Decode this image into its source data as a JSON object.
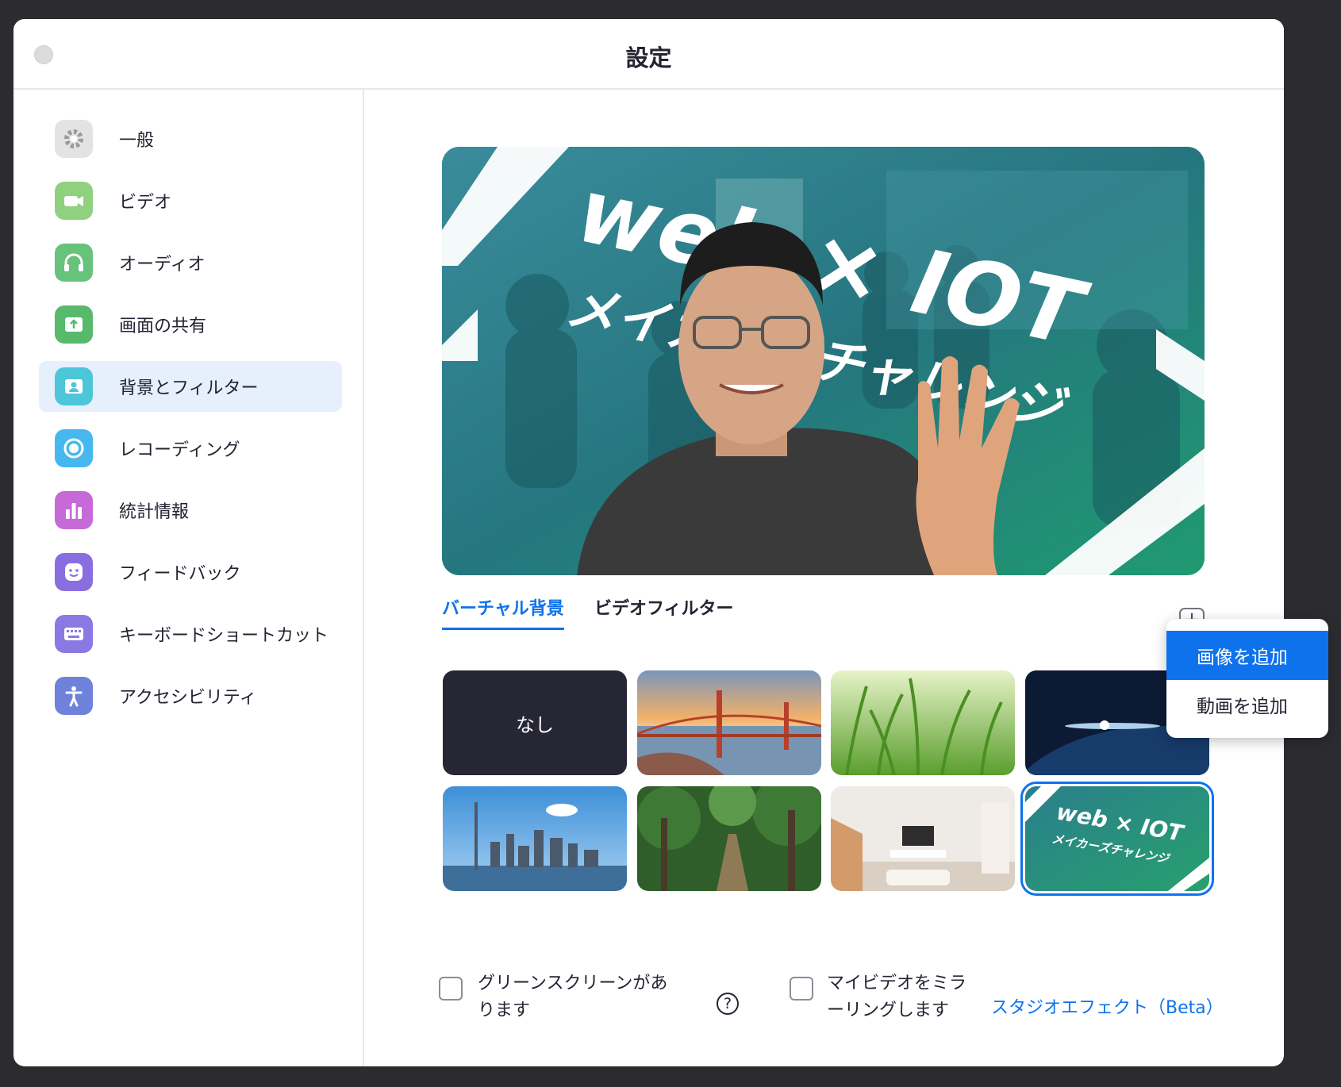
{
  "window": {
    "title": "設定"
  },
  "sidebar": {
    "items": [
      {
        "label": "一般",
        "icon": "gear-icon",
        "color": "#e0e0e0"
      },
      {
        "label": "ビデオ",
        "icon": "video-camera-icon",
        "color": "#8fd17e"
      },
      {
        "label": "オーディオ",
        "icon": "headphones-icon",
        "color": "#67c27b"
      },
      {
        "label": "画面の共有",
        "icon": "share-screen-icon",
        "color": "#56b96c"
      },
      {
        "label": "背景とフィルター",
        "icon": "person-background-icon",
        "color": "#4ec6d9",
        "active": true
      },
      {
        "label": "レコーディング",
        "icon": "record-icon",
        "color": "#46b8ef"
      },
      {
        "label": "統計情報",
        "icon": "bar-chart-icon",
        "color": "#c56ad6"
      },
      {
        "label": "フィードバック",
        "icon": "smiley-icon",
        "color": "#8a6ee0"
      },
      {
        "label": "キーボードショートカット",
        "icon": "keyboard-icon",
        "color": "#8a79e3"
      },
      {
        "label": "アクセシビリティ",
        "icon": "accessibility-icon",
        "color": "#6f82db"
      }
    ]
  },
  "preview": {
    "banner_line1": "web × IOT",
    "banner_line2": "メイカーズチャレンジ"
  },
  "tabs": [
    {
      "label": "バーチャル背景",
      "active": true
    },
    {
      "label": "ビデオフィルター",
      "active": false
    }
  ],
  "add_button": {
    "icon": "plus-icon",
    "glyph": "+"
  },
  "dropdown": {
    "items": [
      {
        "label": "画像を追加",
        "active": true
      },
      {
        "label": "動画を追加",
        "active": false
      }
    ]
  },
  "backgrounds": [
    {
      "label": "なし",
      "kind": "none"
    },
    {
      "kind": "golden-gate-bridge"
    },
    {
      "kind": "grass"
    },
    {
      "kind": "earth-from-space"
    },
    {
      "kind": "toronto-skyline"
    },
    {
      "kind": "forest-path"
    },
    {
      "kind": "living-room"
    },
    {
      "kind": "web-iot-banner",
      "selected": true,
      "line1": "web × IOT",
      "line2": "メイカーズチャレンジ"
    }
  ],
  "options": {
    "green_screen": "グリーンスクリーンがあります",
    "green_screen_line1": "グリーンスクリーンがあ",
    "green_screen_line2": "ります",
    "help_glyph": "?",
    "mirror_line1": "マイビデオをミラ",
    "mirror_line2": "ーリングします",
    "studio_effects": "スタジオエフェクト（Beta）"
  },
  "colors": {
    "accent": "#0e72ed",
    "active_bg": "#e6effc"
  }
}
